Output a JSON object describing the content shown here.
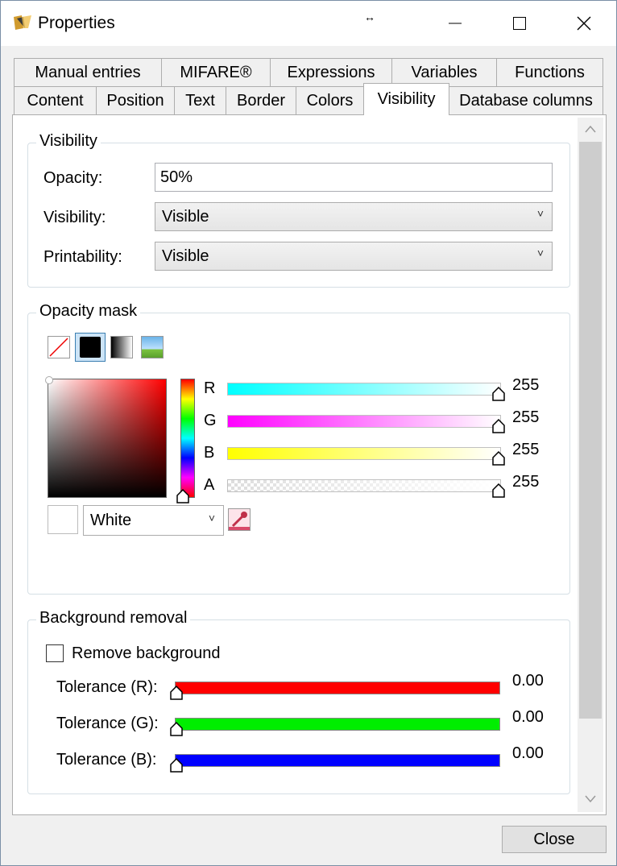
{
  "window": {
    "title": "Properties",
    "resize_glyph": "↔",
    "minimize_glyph": "—",
    "maximize_glyph": "☐",
    "close_glyph": "✕"
  },
  "tabs_row1": [
    "Manual entries",
    "MIFARE®",
    "Expressions",
    "Variables",
    "Functions"
  ],
  "tabs_row2": [
    "Content",
    "Position",
    "Text",
    "Border",
    "Colors",
    "Visibility",
    "Database columns"
  ],
  "active_tab": "Visibility",
  "visibility_group": {
    "legend": "Visibility",
    "opacity_label": "Opacity:",
    "opacity_value": "50%",
    "visibility_label": "Visibility:",
    "visibility_value": "Visible",
    "printability_label": "Printability:",
    "printability_value": "Visible"
  },
  "opacity_mask": {
    "legend": "Opacity mask",
    "brush_types": [
      "no-brush-icon",
      "solid-brush-icon",
      "gradient-brush-icon",
      "image-brush-icon"
    ],
    "selected_brush": "solid-brush-icon",
    "channels": [
      {
        "label": "R",
        "value": "255",
        "gradient": [
          "#00ffff",
          "#ffffff"
        ]
      },
      {
        "label": "G",
        "value": "255",
        "gradient": [
          "#ff00ff",
          "#ffffff"
        ]
      },
      {
        "label": "B",
        "value": "255",
        "gradient": [
          "#ffff00",
          "#ffffff"
        ]
      },
      {
        "label": "A",
        "value": "255",
        "gradient": [
          "checker",
          "#ffffff"
        ]
      }
    ],
    "color_name": "White",
    "current_color": "#ffffff"
  },
  "background_removal": {
    "legend": "Background removal",
    "remove_label": "Remove background",
    "remove_checked": false,
    "tolerances": [
      {
        "label": "Tolerance (R):",
        "value": "0.00",
        "color": "#ff0000"
      },
      {
        "label": "Tolerance (G):",
        "value": "0.00",
        "color": "#00ee00"
      },
      {
        "label": "Tolerance (B):",
        "value": "0.00",
        "color": "#0000ff"
      }
    ]
  },
  "close_button": "Close"
}
